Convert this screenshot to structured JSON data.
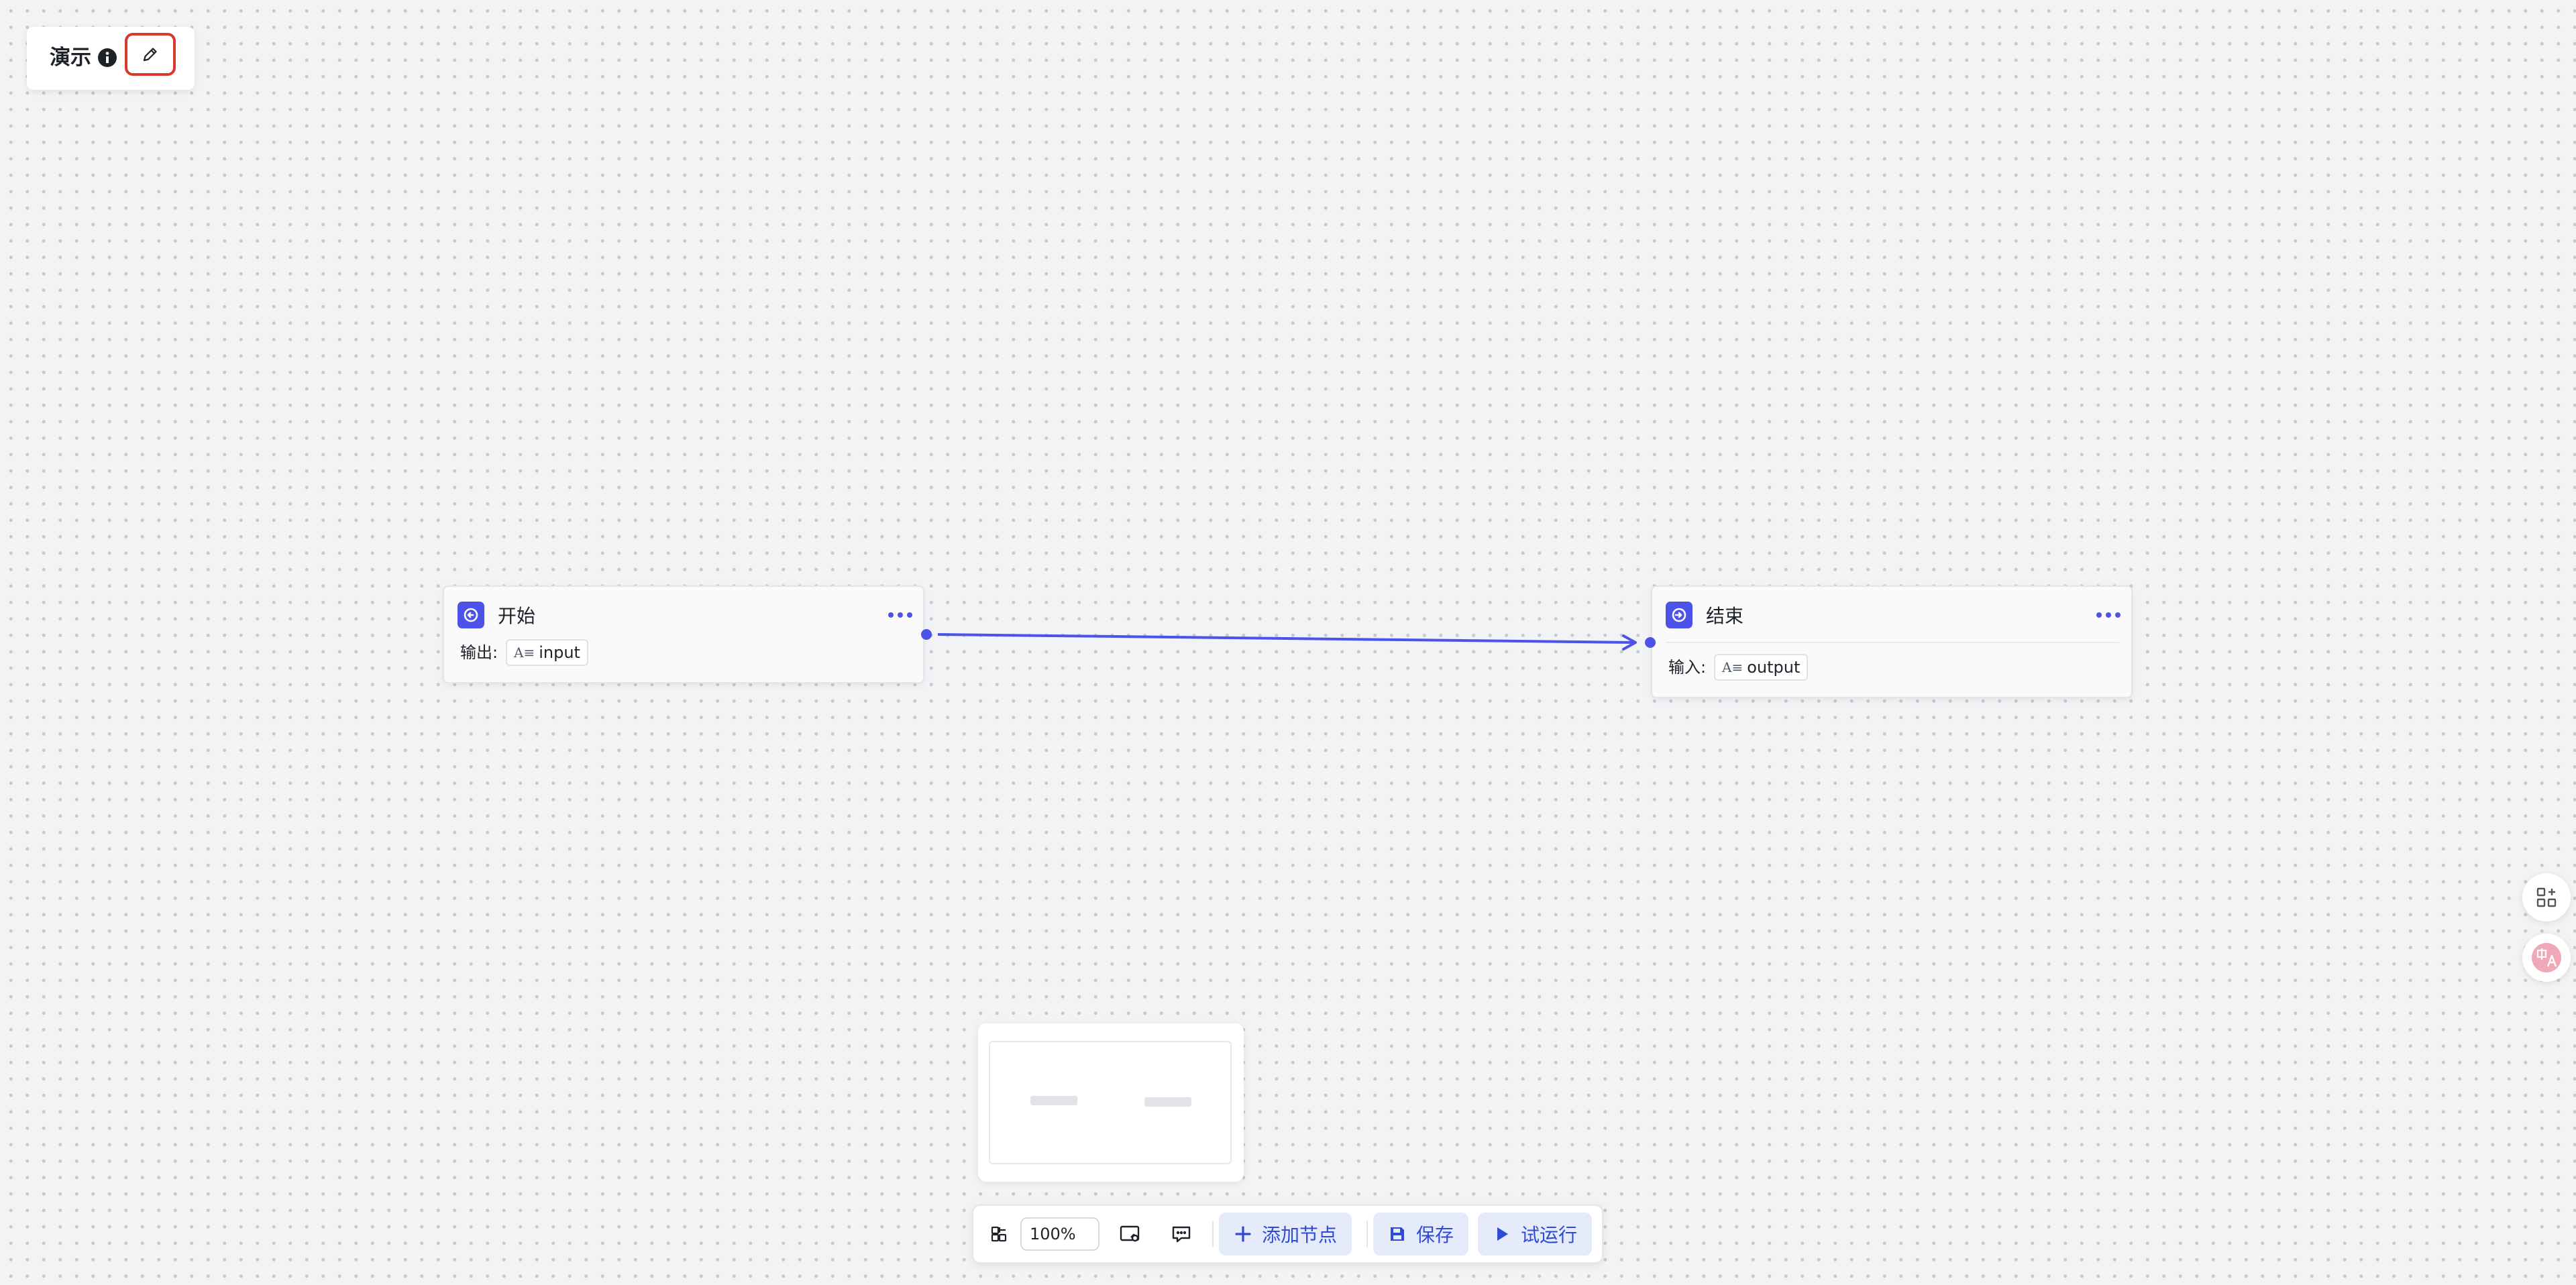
{
  "workflow": {
    "title": "演示"
  },
  "nodes": {
    "start": {
      "title": "开始",
      "io_label": "输出:",
      "variable_type": "A≡",
      "variable_name": "input"
    },
    "end": {
      "title": "结束",
      "io_label": "输入:",
      "variable_type": "A≡",
      "variable_name": "output"
    }
  },
  "toolbar": {
    "zoom": "100%",
    "add_node_label": "添加节点",
    "save_label": "保存",
    "test_run_label": "试运行"
  },
  "colors": {
    "accent": "#4d53e8",
    "button_text": "#2e4bd6",
    "button_bg": "#e5ebfb",
    "highlight_border": "#d9392d",
    "canvas_bg": "#f2f3f5"
  },
  "icons": [
    "info-icon",
    "edit-icon",
    "start-node-icon",
    "end-node-icon",
    "more-icon",
    "minimap-toggle-icon",
    "fit-view-icon",
    "comment-icon",
    "plus-icon",
    "save-icon",
    "play-icon",
    "grid-add-icon",
    "translate-icon"
  ]
}
